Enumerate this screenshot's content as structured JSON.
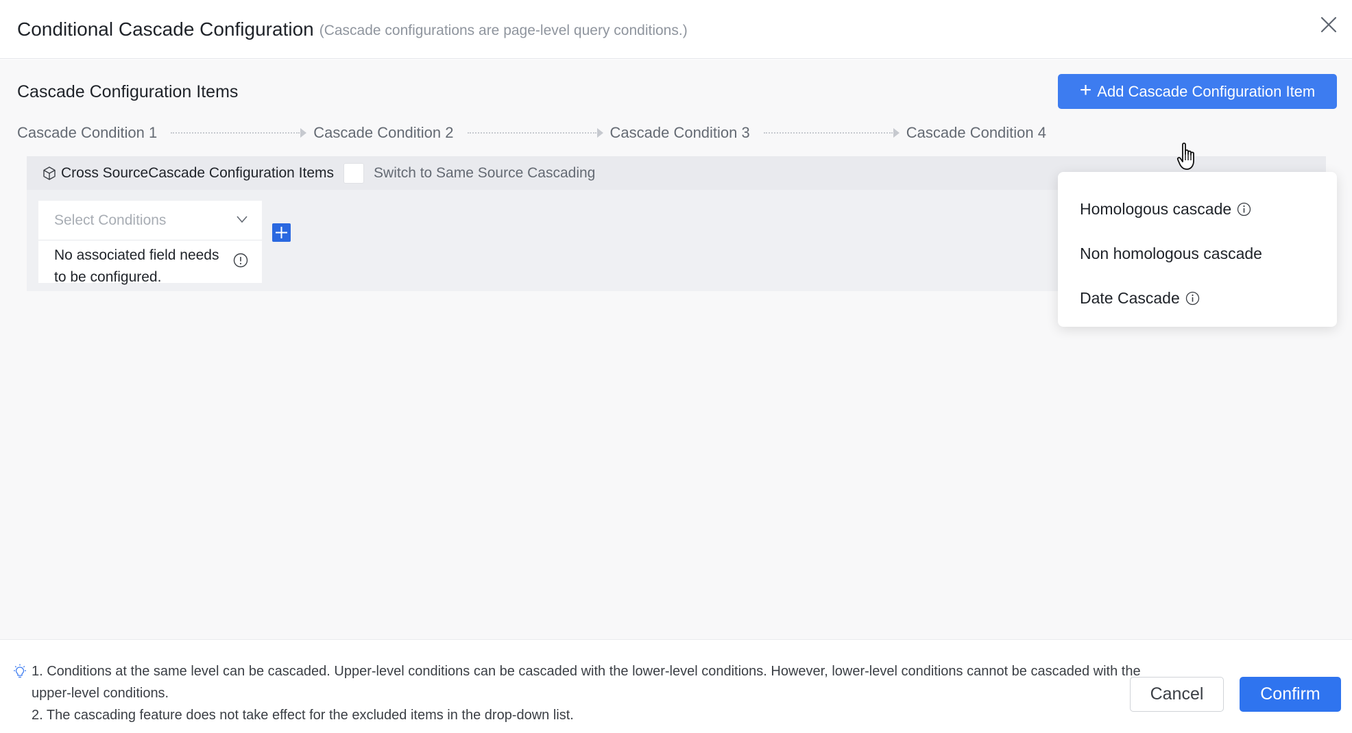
{
  "header": {
    "title": "Conditional Cascade Configuration",
    "subtitle": "(Cascade configurations are page-level query conditions.)"
  },
  "main": {
    "section_title": "Cascade Configuration Items",
    "add_button_label": "Add Cascade Configuration Item",
    "steps": [
      "Cascade Condition 1",
      "Cascade Condition 2",
      "Cascade Condition 3",
      "Cascade Condition 4"
    ],
    "config": {
      "head_label": "Cross SourceCascade Configuration Items",
      "switch_label": "Switch to Same Source Cascading",
      "select_placeholder": "Select Conditions",
      "no_field_text": "No associated field needs to be configured."
    }
  },
  "dropdown": {
    "items": [
      {
        "label": "Homologous cascade"
      },
      {
        "label": "Non homologous cascade"
      },
      {
        "label": "Date Cascade"
      }
    ]
  },
  "footer": {
    "tip_1": "1. Conditions at the same level can be cascaded. Upper-level conditions can be cascaded with the lower-level conditions. However, lower-level conditions cannot be cascaded with the upper-level conditions.",
    "tip_2": "2. The cascading feature does not take effect for the excluded items in the drop-down list.",
    "cancel_label": "Cancel",
    "confirm_label": "Confirm"
  },
  "colors": {
    "primary": "#3d7cf0",
    "confirm": "#2f74ef",
    "plus_square": "#2a68e0"
  }
}
